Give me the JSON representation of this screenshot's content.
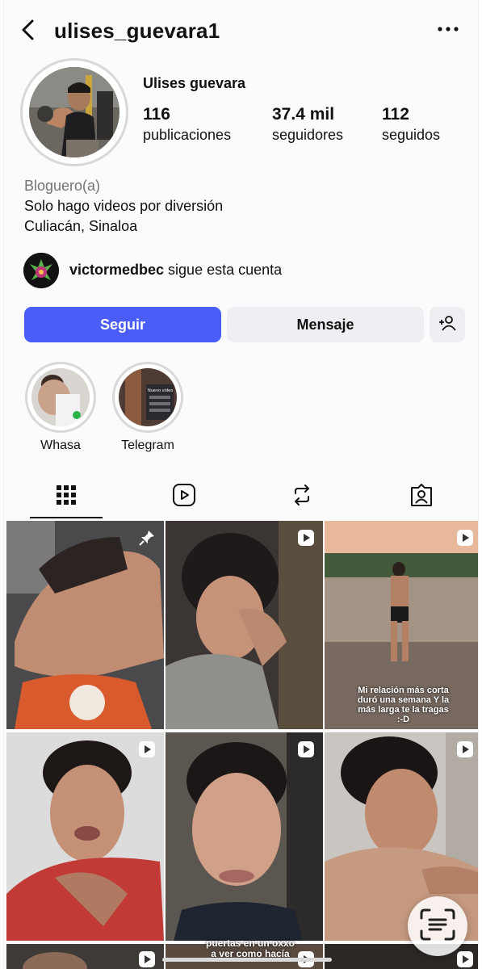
{
  "header": {
    "username": "ulises_guevara1"
  },
  "profile": {
    "display_name": "Ulises guevara",
    "stats": [
      {
        "value": "116",
        "label": "publicaciones"
      },
      {
        "value": "37.4 mil",
        "label": "seguidores"
      },
      {
        "value": "112",
        "label": "seguidos"
      }
    ],
    "bio": {
      "category": "Bloguero(a)",
      "line1": "Solo hago videos por diversión",
      "line2": "Culiacán, Sinaloa"
    },
    "followed_by": {
      "account": "victormedbec",
      "suffix": " sigue esta cuenta"
    }
  },
  "actions": {
    "follow_label": "Seguir",
    "message_label": "Mensaje",
    "add_user_icon": "add-user-icon"
  },
  "highlights": [
    {
      "label": "Whasa"
    },
    {
      "label": "Telegram",
      "cover_text": "Nuevo video"
    }
  ],
  "tabs": [
    {
      "icon": "grid-icon",
      "active": true
    },
    {
      "icon": "reels-icon",
      "active": false
    },
    {
      "icon": "repost-icon",
      "active": false
    },
    {
      "icon": "tagged-icon",
      "active": false
    }
  ],
  "posts": [
    {
      "badge": "pin-icon"
    },
    {
      "badge": "reel-icon"
    },
    {
      "badge": "reel-icon",
      "caption": "Mi relación más corta duró una semana Y la más larga te la tragas :-D"
    },
    {
      "badge": "reel-icon"
    },
    {
      "badge": "reel-icon"
    },
    {
      "badge": "reel-icon"
    }
  ],
  "partial_caption": "puertas en un oxxo a ver como hacía",
  "colors": {
    "accent": "#4a5df9",
    "secondary_button": "#efeff3",
    "muted_text": "#737373"
  }
}
